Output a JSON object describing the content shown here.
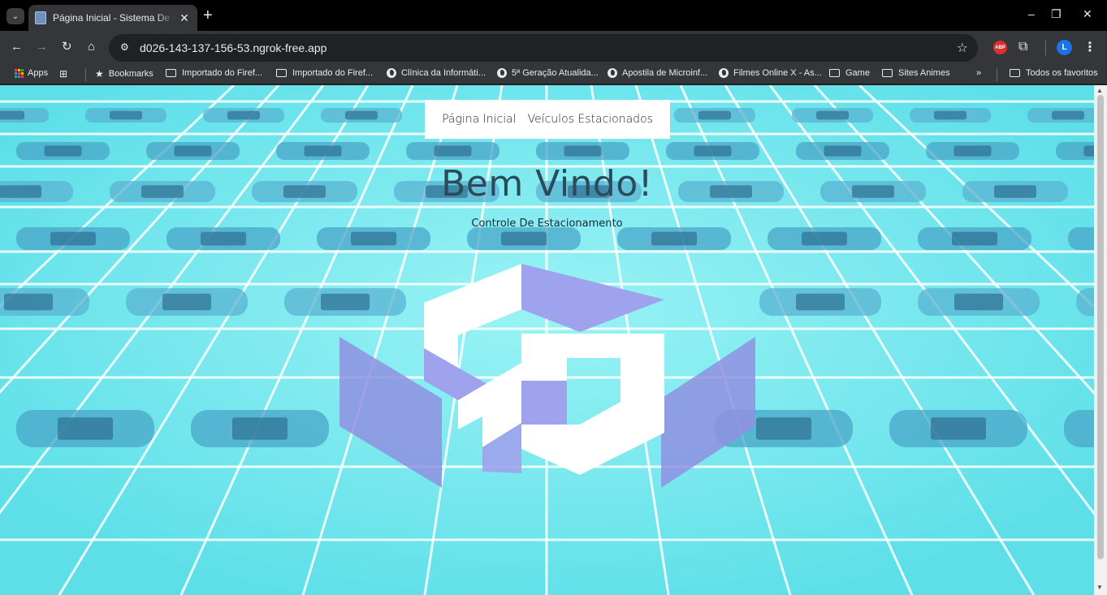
{
  "browser": {
    "tab": {
      "title": "Página Inicial - Sistema De Controle De Estacionamento",
      "close_icon": "✕"
    },
    "new_tab_label": "+",
    "window_controls": {
      "minimize": "–",
      "restore": "❐",
      "close": "✕"
    },
    "url": "d026-143-137-156-53.ngrok-free.app",
    "profile_initial": "L",
    "abp_label": "ABP",
    "bookmarks": [
      {
        "label": "Apps",
        "icon": "apps-icon"
      },
      {
        "label": "",
        "icon": "tab-groups-icon"
      },
      {
        "label": "Bookmarks",
        "icon": "star-icon"
      },
      {
        "label": "Importado do Firef...",
        "icon": "folder-icon"
      },
      {
        "label": "Importado do Firef...",
        "icon": "folder-icon"
      },
      {
        "label": "Clínica da Informáti...",
        "icon": "globe-icon"
      },
      {
        "label": "5ª Geração Atualida...",
        "icon": "globe-icon"
      },
      {
        "label": "Apostila de Microinf...",
        "icon": "globe-icon"
      },
      {
        "label": "Filmes Online X - As...",
        "icon": "globe-icon"
      },
      {
        "label": "Game",
        "icon": "folder-icon"
      },
      {
        "label": "Sites Animes",
        "icon": "folder-icon"
      }
    ],
    "overflow_label": "»",
    "all_bookmarks_label": "Todos os favoritos"
  },
  "page": {
    "nav": {
      "home": "Página Inicial",
      "parked": "Veículos Estacionados"
    },
    "title": "Bem Vindo!",
    "subtitle": "Controle De Estacionamento",
    "background": "parking-lot-photo-cyan-tint",
    "logo": "company-logo"
  },
  "colors": {
    "tint": "#6fe6ec",
    "logo_purple": "#8f91e0",
    "tab_bg": "#35363a",
    "chrome_dark": "#000000"
  }
}
